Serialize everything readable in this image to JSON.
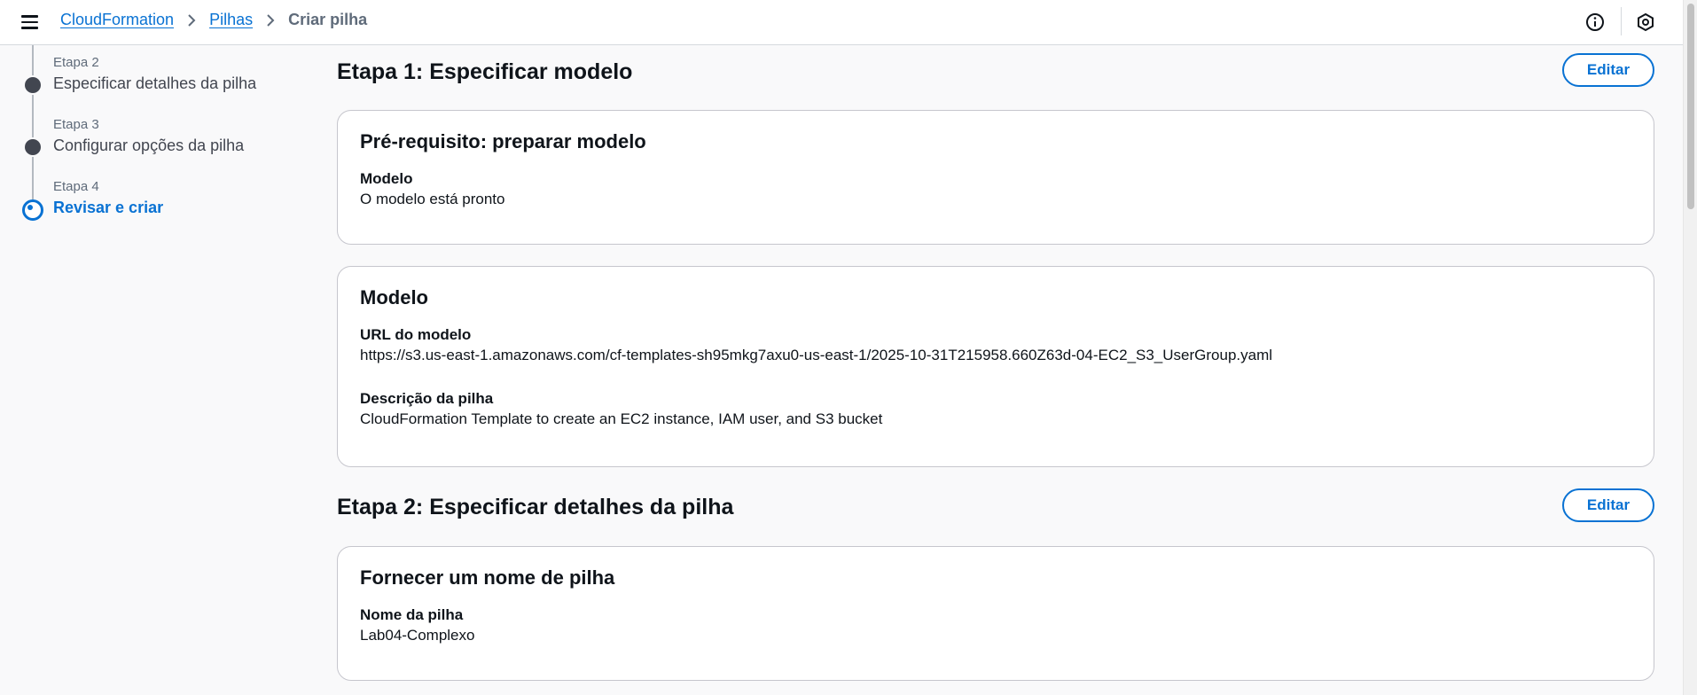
{
  "topbar": {
    "breadcrumbs": [
      {
        "label": "CloudFormation",
        "link": true
      },
      {
        "label": "Pilhas",
        "link": true
      },
      {
        "label": "Criar pilha",
        "link": false
      }
    ],
    "icons": [
      "menu-icon",
      "info-icon",
      "settings-hexagon-icon"
    ]
  },
  "steps": [
    {
      "number": "Etapa 2",
      "title": "Especificar detalhes da pilha",
      "active": false
    },
    {
      "number": "Etapa 3",
      "title": "Configurar opções da pilha",
      "active": false
    },
    {
      "number": "Etapa 4",
      "title": "Revisar e criar",
      "active": true
    }
  ],
  "sections": {
    "step1": {
      "title": "Etapa 1: Especificar modelo",
      "edit_label": "Editar",
      "prereq_card": {
        "title": "Pré-requisito: preparar modelo",
        "fields": [
          {
            "label": "Modelo",
            "value": "O modelo está pronto"
          }
        ]
      },
      "model_card": {
        "title": "Modelo",
        "fields": [
          {
            "label": "URL do modelo",
            "value": "https://s3.us-east-1.amazonaws.com/cf-templates-sh95mkg7axu0-us-east-1/2025-10-31T215958.660Z63d-04-EC2_S3_UserGroup.yaml"
          },
          {
            "label": "Descrição da pilha",
            "value": "CloudFormation Template to create an EC2 instance, IAM user, and S3 bucket"
          }
        ]
      }
    },
    "step2": {
      "title": "Etapa 2: Especificar detalhes da pilha",
      "edit_label": "Editar",
      "name_card": {
        "title": "Fornecer um nome de pilha",
        "fields": [
          {
            "label": "Nome da pilha",
            "value": "Lab04-Complexo"
          }
        ]
      }
    }
  },
  "colors": {
    "accent": "#0972d3",
    "text": "#0f141a",
    "muted": "#5f6b7a",
    "background": "#f9f9fa"
  }
}
